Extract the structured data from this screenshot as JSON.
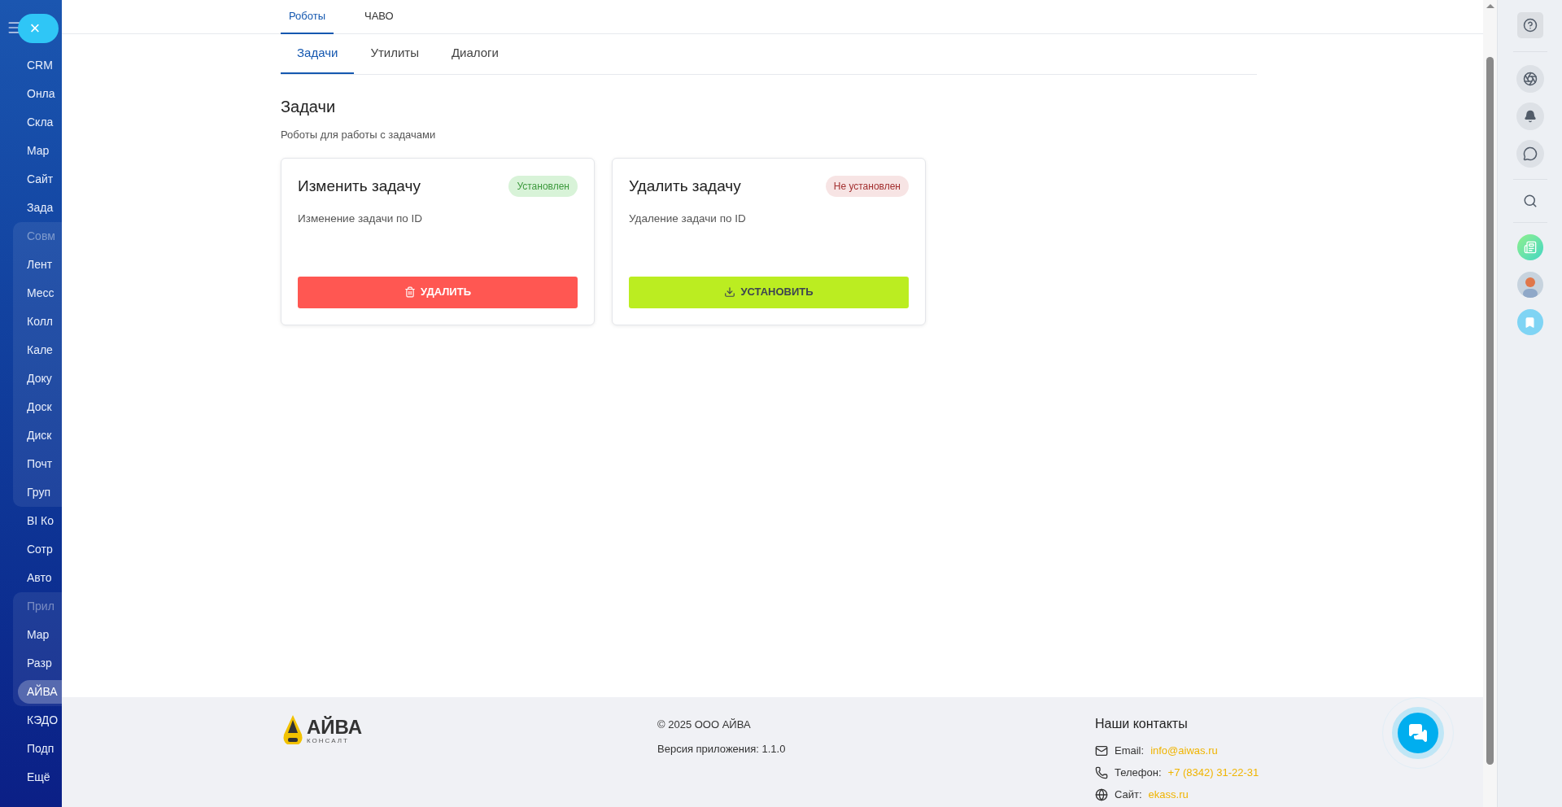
{
  "sidebar": {
    "close_button": "×",
    "sections": [
      {
        "kind": "plain",
        "items": [
          {
            "label": "CRM",
            "selected": false
          },
          {
            "label": "Онла",
            "selected": false
          },
          {
            "label": "Скла",
            "selected": false
          },
          {
            "label": "Мар",
            "selected": false
          },
          {
            "label": "Сайт",
            "selected": false
          },
          {
            "label": "Зада",
            "selected": false
          }
        ]
      },
      {
        "kind": "group",
        "header": "Совм",
        "items": [
          {
            "label": "Лент",
            "selected": false
          },
          {
            "label": "Месс",
            "selected": false
          },
          {
            "label": "Колл",
            "selected": false
          },
          {
            "label": "Кале",
            "selected": false
          },
          {
            "label": "Доку",
            "selected": false
          },
          {
            "label": "Доск",
            "selected": false
          },
          {
            "label": "Диск",
            "selected": false
          },
          {
            "label": "Почт",
            "selected": false
          },
          {
            "label": "Груп",
            "selected": false
          }
        ]
      },
      {
        "kind": "plain",
        "items": [
          {
            "label": "BI Ко",
            "selected": false
          },
          {
            "label": "Сотр",
            "selected": false
          },
          {
            "label": "Авто",
            "selected": false
          }
        ]
      },
      {
        "kind": "group",
        "header": "Прил",
        "items": [
          {
            "label": "Мар",
            "selected": false
          },
          {
            "label": "Разр",
            "selected": false
          },
          {
            "label": "АЙВА",
            "selected": true
          }
        ]
      },
      {
        "kind": "plain",
        "items": [
          {
            "label": "КЭДО",
            "selected": false
          },
          {
            "label": "Подп",
            "selected": false
          },
          {
            "label": "Ещё",
            "selected": false
          }
        ]
      }
    ]
  },
  "tabs": [
    {
      "label": "Роботы",
      "selected": true
    },
    {
      "label": "ЧАВО",
      "selected": false
    }
  ],
  "subtabs": [
    {
      "label": "Задачи",
      "selected": true
    },
    {
      "label": "Утилиты",
      "selected": false
    },
    {
      "label": "Диалоги",
      "selected": false
    }
  ],
  "section": {
    "title": "Задачи",
    "subtitle": "Роботы для работы с задачами"
  },
  "cards": [
    {
      "title": "Изменить задачу",
      "badge": "Установлен",
      "installed": true,
      "description": "Изменение задачи по ID",
      "button": {
        "label": "УДАЛИТЬ",
        "kind": "delete"
      }
    },
    {
      "title": "Удалить задачу",
      "badge": "Не установлен",
      "installed": false,
      "description": "Удаление задачи по ID",
      "button": {
        "label": "УСТАНОВИТЬ",
        "kind": "install"
      }
    }
  ],
  "footer": {
    "logo": {
      "main": "АЙВА",
      "sub": "КОНСАЛТ"
    },
    "copyright": "© 2025 ООО АЙВА",
    "version": "Версия приложения: 1.1.0",
    "contacts_title": "Наши контакты",
    "contacts": [
      {
        "kind": "email",
        "label": "Email:",
        "value": "info@aiwas.ru"
      },
      {
        "kind": "phone",
        "label": "Телефон:",
        "value": "+7 (8342) 31-22-31"
      },
      {
        "kind": "site",
        "label": "Сайт:",
        "value": "ekass.ru"
      }
    ]
  }
}
